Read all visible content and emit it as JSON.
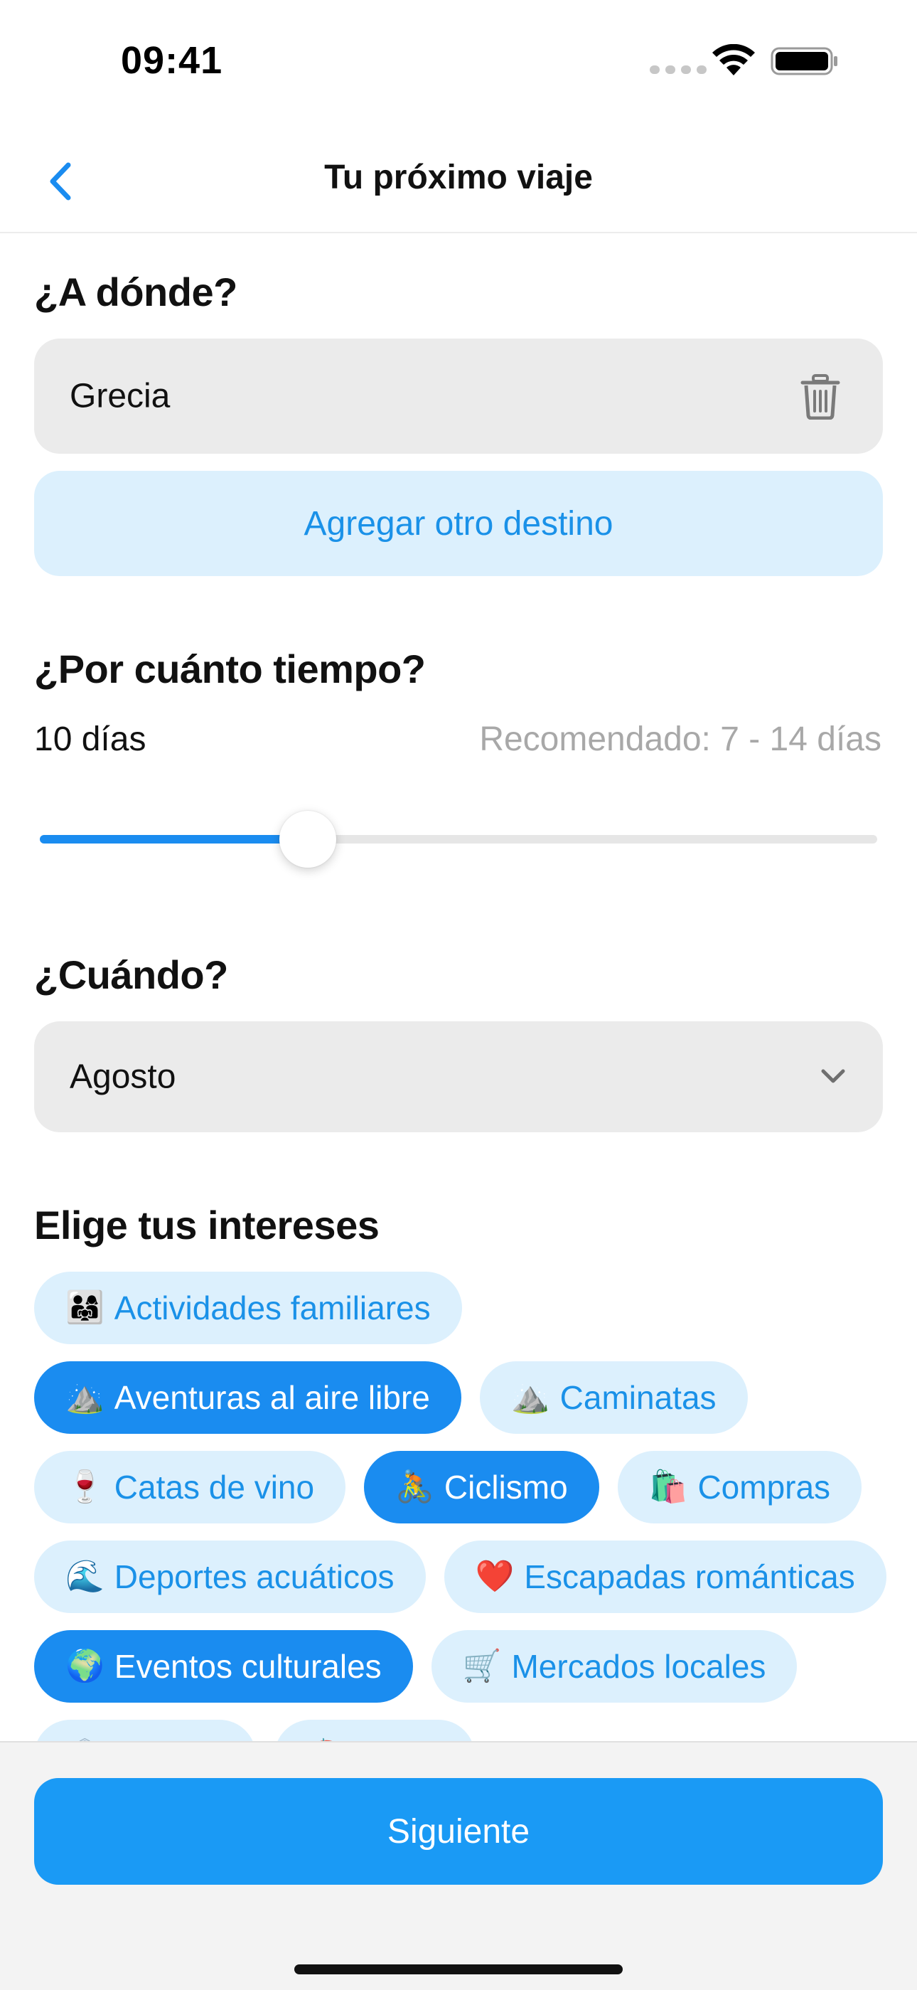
{
  "status_bar": {
    "time": "09:41"
  },
  "nav": {
    "title": "Tu próximo viaje",
    "back_icon": "chevron-left-icon"
  },
  "destination": {
    "title": "¿A dónde?",
    "value": "Grecia",
    "add_label": "Agregar otro destino",
    "delete_icon": "trash-icon"
  },
  "duration": {
    "title": "¿Por cuánto tiempo?",
    "value_label": "10 días",
    "recommended": "Recomendado: 7 - 14 días",
    "slider_fraction": 0.32
  },
  "when": {
    "title": "¿Cuándo?",
    "selected": "Agosto",
    "dropdown_icon": "chevron-down-icon"
  },
  "interests": {
    "title": "Elige tus intereses",
    "rows": [
      [
        {
          "emoji": "👨‍👩‍👧",
          "label": "Actividades familiares",
          "selected": false
        }
      ],
      [
        {
          "emoji": "⛰️",
          "label": "Aventuras al aire libre",
          "selected": true
        },
        {
          "emoji": "⛰️",
          "label": "Caminatas",
          "selected": false
        }
      ],
      [
        {
          "emoji": "🍷",
          "label": "Catas de vino",
          "selected": false
        },
        {
          "emoji": "🚴",
          "label": "Ciclismo",
          "selected": true
        },
        {
          "emoji": "🛍️",
          "label": "Compras",
          "selected": false
        }
      ],
      [
        {
          "emoji": "🌊",
          "label": "Deportes acuáticos",
          "selected": false
        },
        {
          "emoji": "❤️",
          "label": "Escapadas románticas",
          "selected": false
        }
      ],
      [
        {
          "emoji": "🌍",
          "label": "Eventos culturales",
          "selected": true
        },
        {
          "emoji": "🛒",
          "label": "Mercados locales",
          "selected": false
        }
      ],
      [
        {
          "emoji": "🏛️",
          "label": "",
          "selected": false
        },
        {
          "emoji": "🏖️",
          "label": "",
          "selected": false
        }
      ]
    ]
  },
  "footer": {
    "next_label": "Siguiente"
  },
  "colors": {
    "accent": "#1a8cf0",
    "chip_bg": "#dcf0fd",
    "field_bg": "#ebebeb"
  }
}
